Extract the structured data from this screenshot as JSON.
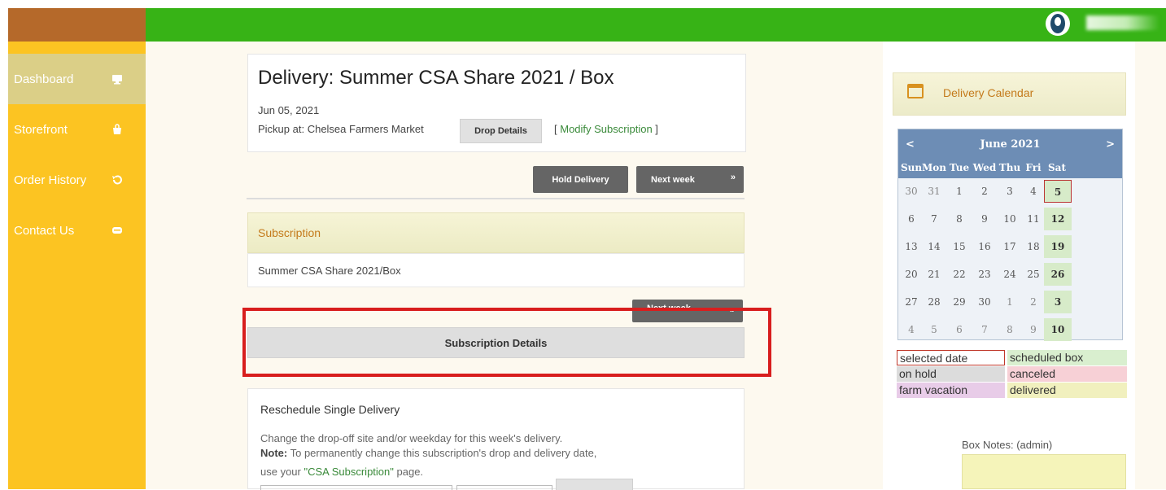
{
  "sidebar": {
    "items": [
      {
        "label": "Dashboard",
        "icon": "monitor-icon",
        "active": true
      },
      {
        "label": "Storefront",
        "icon": "shopping-bag-icon",
        "active": false
      },
      {
        "label": "Order History",
        "icon": "history-icon",
        "active": false
      },
      {
        "label": "Contact Us",
        "icon": "chat-icon",
        "active": false
      }
    ]
  },
  "delivery": {
    "title": "Delivery: Summer CSA Share 2021 / Box",
    "date": "Jun 05, 2021",
    "pickup": "Pickup at: Chelsea Farmers Market",
    "drop_details_label": "Drop Details",
    "modify_open": "[ ",
    "modify_link": "Modify Subscription",
    "modify_close": " ]",
    "hold_label": "Hold Delivery",
    "next_week_label": "Next week",
    "next_arrow": "»"
  },
  "subscription": {
    "header": "Subscription",
    "name": "Summer CSA Share 2021/Box",
    "next_week_label": "Next week",
    "next_arrow": "»",
    "details_label": "Subscription Details"
  },
  "reschedule": {
    "title": "Reschedule Single Delivery",
    "line1": "Change the drop-off site and/or weekday for this week's delivery.",
    "note_label": "Note:",
    "note_text": " To permanently change this subscription's drop and delivery date,",
    "line3_prefix": "use your ",
    "line3_link": "\"CSA Subscription\"",
    "line3_suffix": " page."
  },
  "calendar": {
    "header": "Delivery Calendar",
    "prev": "<",
    "next": ">",
    "month": "June 2021",
    "dow": [
      "Sun",
      "Mon",
      "Tue",
      "Wed",
      "Thu",
      "Fri",
      "Sat"
    ],
    "weeks": [
      [
        "30",
        "31",
        "1",
        "2",
        "3",
        "4",
        "5"
      ],
      [
        "6",
        "7",
        "8",
        "9",
        "10",
        "11",
        "12"
      ],
      [
        "13",
        "14",
        "15",
        "16",
        "17",
        "18",
        "19"
      ],
      [
        "20",
        "21",
        "22",
        "23",
        "24",
        "25",
        "26"
      ],
      [
        "27",
        "28",
        "29",
        "30",
        "1",
        "2",
        "3"
      ],
      [
        "4",
        "5",
        "6",
        "7",
        "8",
        "9",
        "10"
      ]
    ],
    "selected": "5",
    "legend": [
      {
        "label": "selected date",
        "color": "#ffffff",
        "border": "#c0392b"
      },
      {
        "label": "scheduled box",
        "color": "#d9efcf"
      },
      {
        "label": "on hold",
        "color": "#dcdcdc"
      },
      {
        "label": "canceled",
        "color": "#f7d0d6"
      },
      {
        "label": "farm vacation",
        "color": "#e8cce8"
      },
      {
        "label": "delivered",
        "color": "#f1f0be"
      }
    ]
  },
  "box_notes": {
    "label": "Box Notes: (admin)"
  },
  "colors": {
    "topbar": "#37b316",
    "sidebar": "#fcc422",
    "accent_header": "#c47a1b",
    "calendar_header": "#6d8db5"
  }
}
